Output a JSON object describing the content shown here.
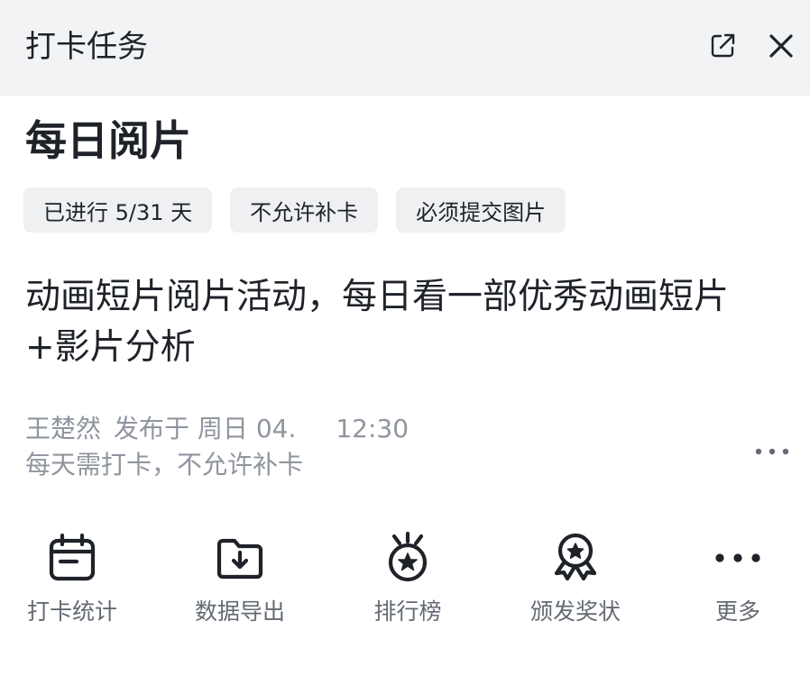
{
  "header": {
    "title": "打卡任务",
    "open_icon": "open-external-icon",
    "close_icon": "close-icon"
  },
  "task": {
    "title": "每日阅片",
    "tags": [
      "已进行 5/31 天",
      "不允许补卡",
      "必须提交图片"
    ],
    "description": "动画短片阅片活动，每日看一部优秀动画短片+影片分析",
    "meta": {
      "author": "王楚然",
      "published": "发布于 周日 04.",
      "time": "12:30",
      "rule": "每天需打卡，不允许补卡"
    },
    "more_icon": "more-horizontal-icon"
  },
  "actions": [
    {
      "label": "打卡统计",
      "icon": "calendar-stats-icon"
    },
    {
      "label": "数据导出",
      "icon": "folder-download-icon"
    },
    {
      "label": "排行榜",
      "icon": "star-medal-icon"
    },
    {
      "label": "颁发奖状",
      "icon": "award-ribbon-icon"
    },
    {
      "label": "更多",
      "icon": "more-horizontal-icon"
    }
  ],
  "colors": {
    "header_bg": "#f2f3f5",
    "tag_bg": "#eff0f2",
    "text_primary": "#1f2329",
    "text_secondary": "#8f959e",
    "label_gray": "#646a73"
  }
}
